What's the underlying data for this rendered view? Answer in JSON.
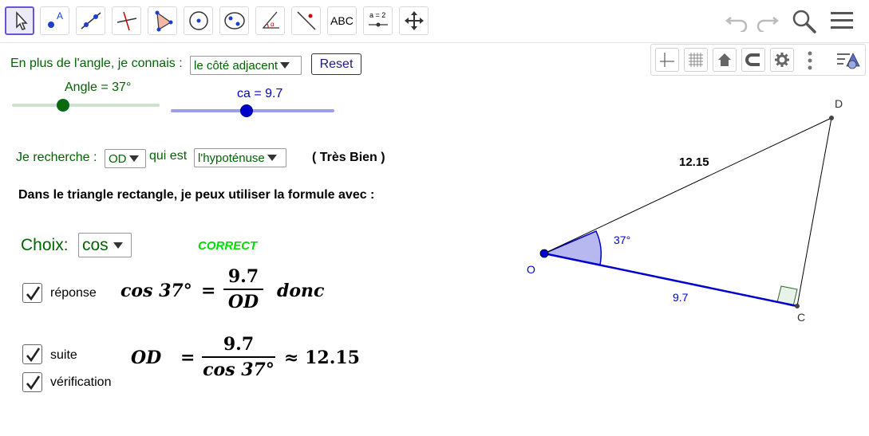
{
  "toolbar": {
    "tools": [
      "move-tool",
      "point-tool",
      "line-tool",
      "perpendicular-tool",
      "polygon-tool",
      "circle-tool",
      "conic-tool",
      "angle-tool",
      "reflect-tool",
      "text-tool",
      "slider-tool",
      "move-view-tool"
    ],
    "text_tool_label": "ABC",
    "slider_tool_label": "a = 2"
  },
  "labels": {
    "know_prefix": "En plus de l'angle, je connais :",
    "know_select": "le côté adjacent",
    "reset": "Reset",
    "angle_slider": "Angle = 37°",
    "ca_slider": "ca = 9.7",
    "search_prefix": "Je recherche :",
    "search_select": "OD",
    "search_mid": "qui est",
    "side_select": "l'hypoténuse",
    "feedback": "( Très Bien )",
    "instruction": "Dans le triangle rectangle, je peux utiliser la formule avec :",
    "choice_label": "Choix:",
    "choice_select": "cos",
    "correct": "CORRECT",
    "cb_answer": "réponse",
    "cb_next": "suite",
    "cb_check": "vérification"
  },
  "sliders": {
    "angle": {
      "value": 37,
      "fraction": 0.34
    },
    "ca": {
      "value": 9.7,
      "fraction": 0.46
    }
  },
  "formula1": {
    "lhs": "cos 37°",
    "eq": "=",
    "num": "9.7",
    "den": "OD",
    "tail": "donc"
  },
  "formula2": {
    "lhs": "OD",
    "eq": "=",
    "num": "9.7",
    "den": "cos 37°",
    "tail": "≈ 12.15"
  },
  "figure": {
    "point_o": "O",
    "point_c": "C",
    "point_d": "D",
    "hyp_length": "12.15",
    "adj_length": "9.7",
    "angle": "37°"
  },
  "colors": {
    "green_text": "#006400",
    "blue_text": "#0000cc",
    "correct": "#00dd00",
    "slider_green": "#006400",
    "slider_blue": "#0000cc"
  }
}
